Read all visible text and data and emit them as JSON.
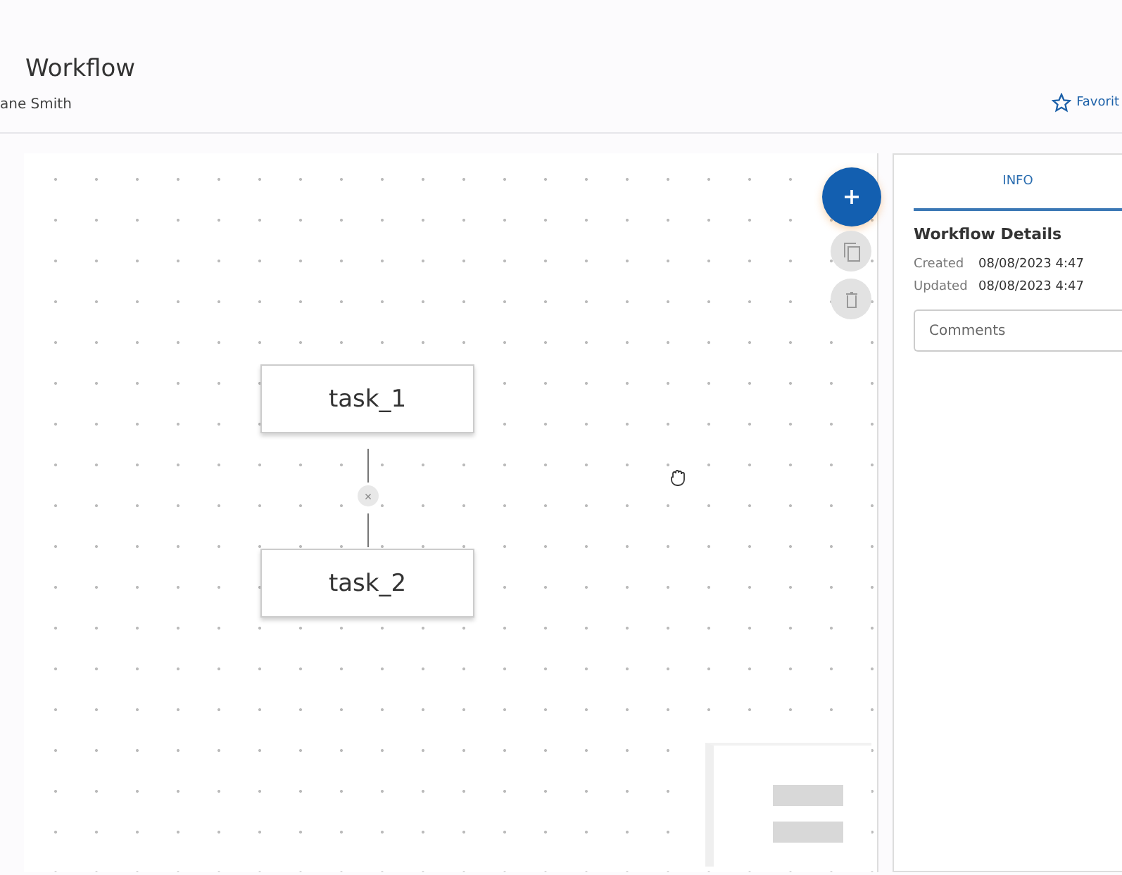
{
  "header": {
    "title": "Workflow",
    "owner": "ane Smith",
    "favorite": {
      "label": "Favorit",
      "on": false
    }
  },
  "canvas": {
    "nodes": [
      {
        "label": "task_1"
      },
      {
        "label": "task_2"
      }
    ],
    "edge_delete": "×"
  },
  "actions": [
    {
      "kind": "add",
      "disabled": false
    },
    {
      "kind": "copy",
      "disabled": true
    },
    {
      "kind": "delete",
      "disabled": true
    }
  ],
  "panel": {
    "tabs": [
      {
        "label": "INFO",
        "selected": true
      }
    ],
    "heading": "Workflow Details",
    "details": [
      {
        "label": "Created",
        "value": "08/08/2023 4:47"
      },
      {
        "label": "Updated",
        "value": "08/08/2023 4:47"
      }
    ],
    "comments": {
      "placeholder": "Comments"
    }
  }
}
